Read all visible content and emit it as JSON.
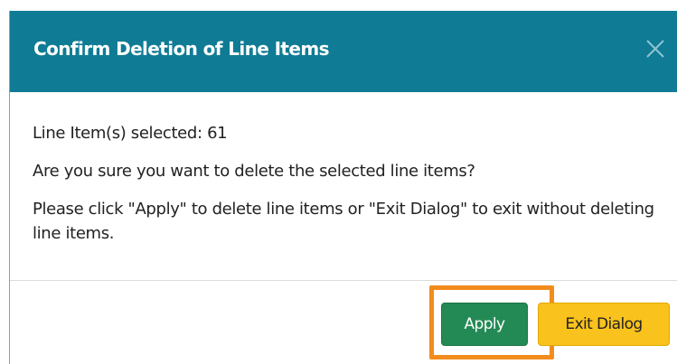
{
  "dialog": {
    "title": "Confirm Deletion of Line Items",
    "close_icon": "close-icon",
    "header_color": "#0f7b94",
    "body": {
      "line_count": "Line Item(s) selected: 61",
      "question": "Are you sure you want to delete the selected line items?",
      "instructions": "Please click \"Apply\" to delete line items or \"Exit Dialog\" to exit without deleting line items."
    },
    "buttons": {
      "apply_label": "Apply",
      "apply_color": "#248a55",
      "exit_label": "Exit Dialog",
      "exit_color": "#f9c21d"
    },
    "highlight_color": "#f28c1c"
  }
}
